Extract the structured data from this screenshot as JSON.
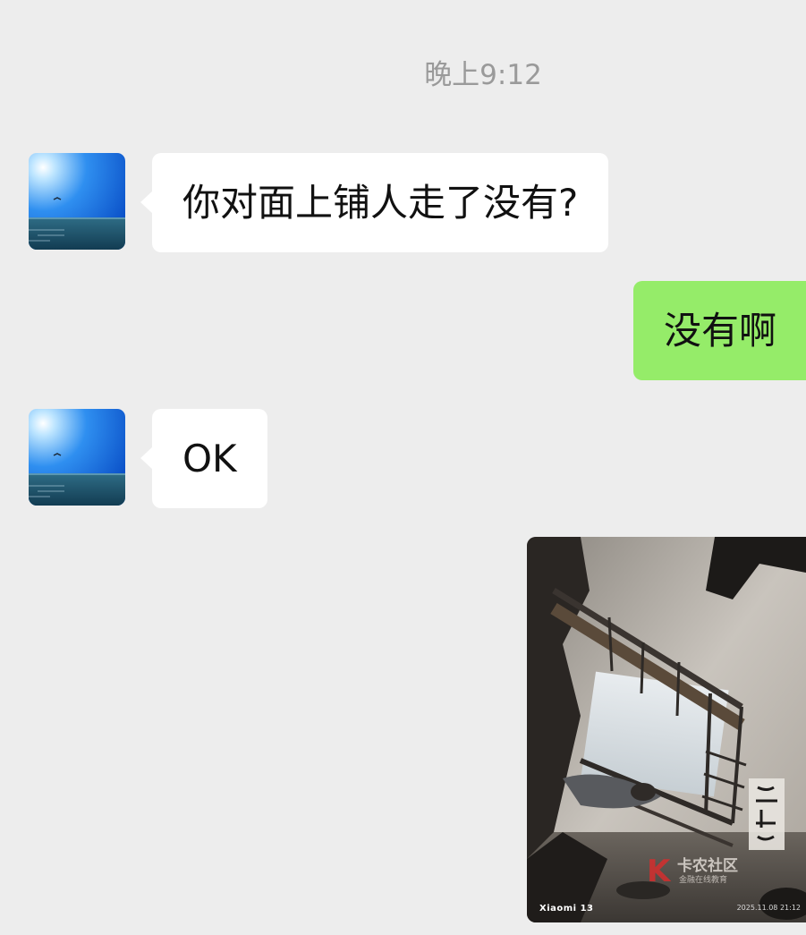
{
  "chat": {
    "timestamp": "晚上9:12",
    "messages": [
      {
        "from": "contact",
        "type": "text",
        "text": "你对面上铺人走了没有?"
      },
      {
        "from": "me",
        "type": "text",
        "text": "没有啊"
      },
      {
        "from": "contact",
        "type": "text",
        "text": "OK"
      },
      {
        "from": "me",
        "type": "image",
        "camera_brand": "Xiaomi 13",
        "photo_date": "2025.11.08 21:12",
        "watermark": {
          "logo": "K",
          "title": "卡农社区",
          "subtitle": "金融在线教育"
        }
      }
    ]
  },
  "colors": {
    "background": "#ededed",
    "incoming_bubble": "#ffffff",
    "outgoing_bubble": "#95ec69",
    "timestamp_text": "#9a9a9a"
  },
  "icons": {
    "avatar": "avatar-sea-sky-icon"
  }
}
